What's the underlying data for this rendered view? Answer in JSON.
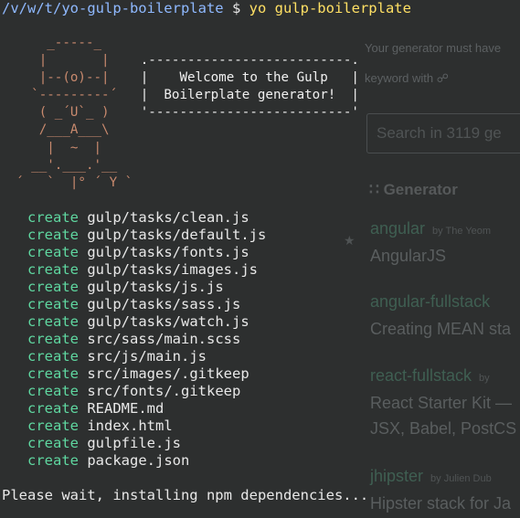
{
  "background_page": {
    "intro_text": "Your generator must have",
    "intro_text2": "keyword with",
    "search_placeholder": "Search in 3119 ge",
    "heading": "Generator",
    "generators": [
      {
        "name": "angular",
        "by": "by The Yeom",
        "description": "AngularJS"
      },
      {
        "name": "angular-fullstack",
        "by": "",
        "description": "Creating MEAN sta"
      },
      {
        "name": "react-fullstack",
        "by": "by",
        "description": "React Starter Kit —"
      },
      {
        "name": "",
        "by": "",
        "description": "JSX, Babel, PostCS"
      },
      {
        "name": "jhipster",
        "by": "by Julien Dub",
        "description": "Hipster stack for Ja"
      }
    ]
  },
  "terminal": {
    "prompt_path": "/v/w/t/yo-gulp-boilerplate",
    "prompt_symbol": " $ ",
    "command": "yo gulp-boilerplate",
    "welcome_line1": "Welcome to the Gulp",
    "welcome_line2": "Boilerplate generator!",
    "create_label": "create",
    "created_files": [
      "gulp/tasks/clean.js",
      "gulp/tasks/default.js",
      "gulp/tasks/fonts.js",
      "gulp/tasks/images.js",
      "gulp/tasks/js.js",
      "gulp/tasks/sass.js",
      "gulp/tasks/watch.js",
      "src/sass/main.scss",
      "src/js/main.js",
      "src/images/.gitkeep",
      "src/fonts/.gitkeep",
      "README.md",
      "index.html",
      "gulpfile.js",
      "package.json"
    ],
    "status_message": "Please wait, installing npm dependencies..."
  },
  "colors": {
    "terminal_bg": "#2d2f2f",
    "path": "#8fb9ff",
    "command": "#ffe064",
    "create": "#5fd7a0",
    "ascii_face": "#c98a6e"
  }
}
